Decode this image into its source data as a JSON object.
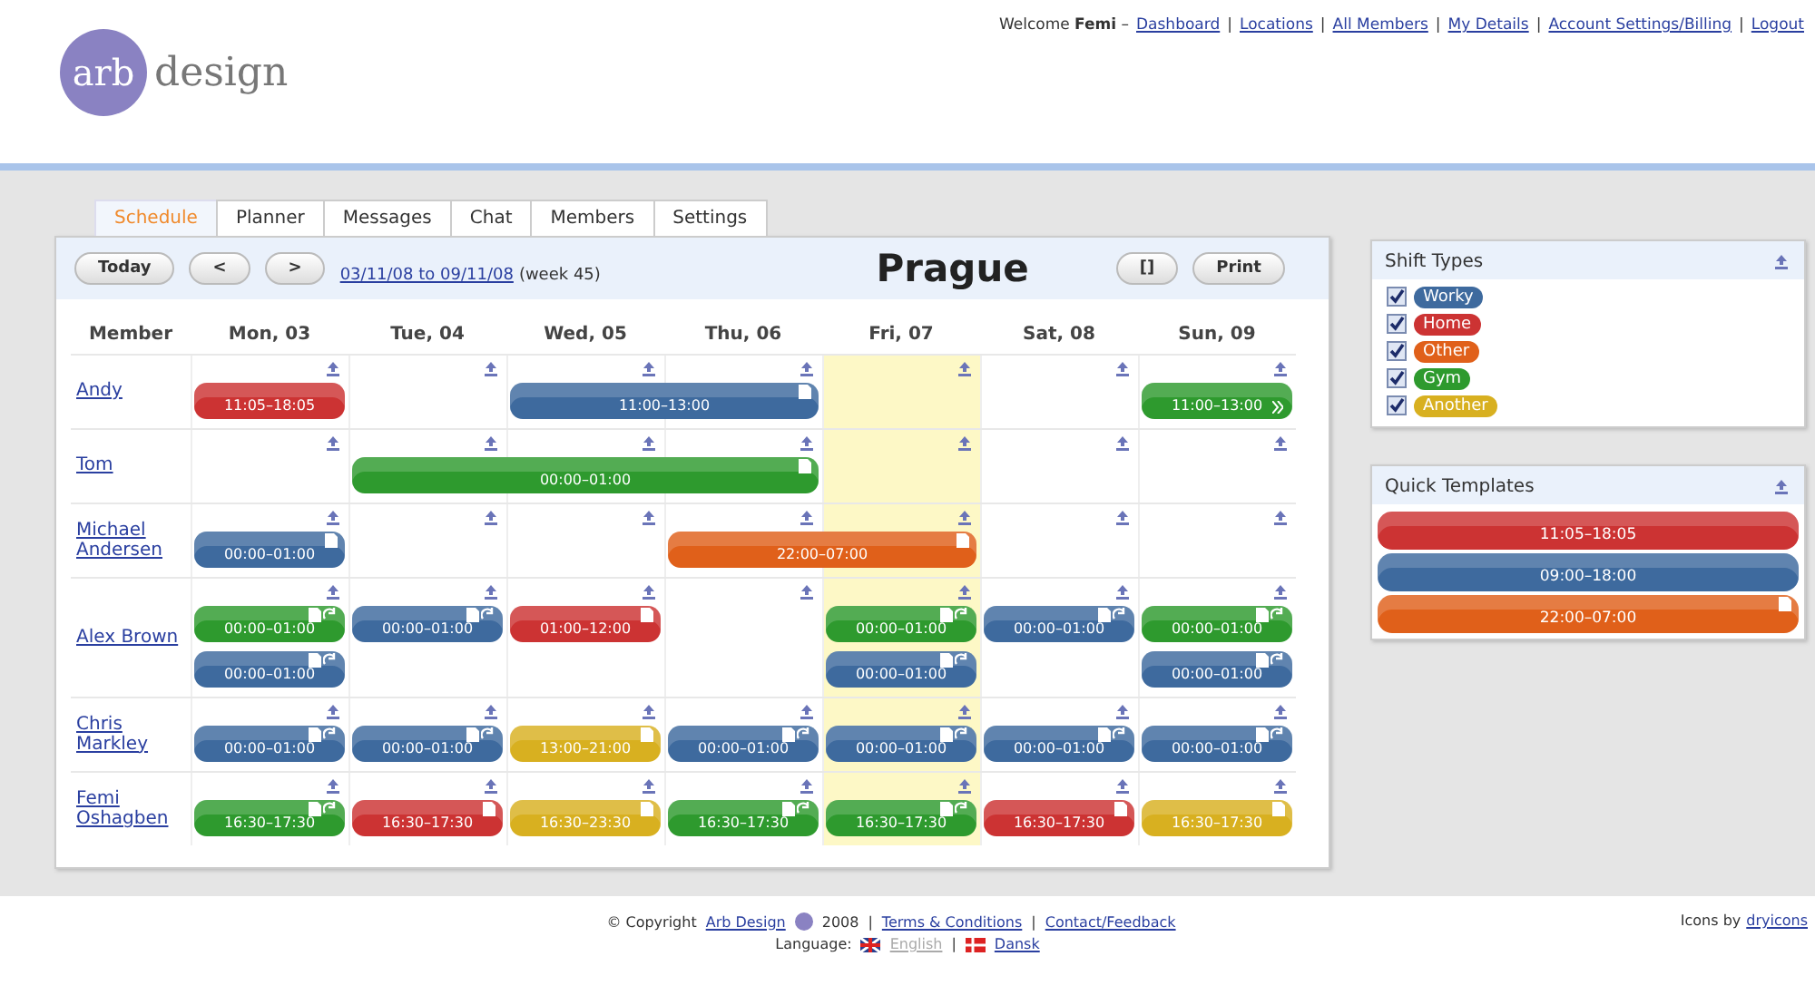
{
  "header": {
    "logo": {
      "mark": "arb",
      "word": "design"
    },
    "welcome": "Welcome **Femi** –",
    "links": [
      {
        "label": "Dashboard"
      },
      {
        "separator": "|",
        "label": "Locations"
      },
      {
        "separator": "|",
        "label": "All Members"
      },
      {
        "separator": "|",
        "label": "My Details"
      },
      {
        "separator": "|",
        "label": "Account Settings/Billing"
      },
      {
        "separator": "|",
        "label": "Logout"
      }
    ]
  },
  "tabs": [
    {
      "label": "Schedule",
      "selected": true
    },
    {
      "label": "Planner",
      "selected": false
    },
    {
      "label": "Messages",
      "selected": false
    },
    {
      "label": "Chat",
      "selected": false
    },
    {
      "label": "Members",
      "selected": false
    },
    {
      "label": "Settings",
      "selected": false
    }
  ],
  "toolbar": {
    "today": "Today",
    "prev": "<",
    "next": ">",
    "range": "03/11/08 to 09/11/08",
    "week": "(week 45)",
    "location": "Prague",
    "toggle": "[]",
    "print": "Print"
  },
  "member_heading": "Member",
  "days": [
    {
      "label": "Mon, 03",
      "highlighted": false
    },
    {
      "label": "Tue, 04",
      "highlighted": false
    },
    {
      "label": "Wed, 05",
      "highlighted": false
    },
    {
      "label": "Thu, 06",
      "highlighted": false
    },
    {
      "label": "Fri, 07",
      "highlighted": true
    },
    {
      "label": "Sat, 08",
      "highlighted": false
    },
    {
      "label": "Sun, 09",
      "highlighted": false
    }
  ],
  "members": [
    {
      "name": "Andy",
      "lanes": [
        {
          "cells": [
            {
              "kind": "shift",
              "time": "11:05–18:05",
              "color": "#cc3333",
              "note": false,
              "repeat": false,
              "more": false
            },
            {
              "kind": "empty"
            },
            {
              "kind": "shift",
              "time": "11:00–13:00",
              "color": "#3e6a9e",
              "note": true,
              "repeat": false,
              "more": false
            },
            {
              "kind": "continued"
            },
            {
              "kind": "empty"
            },
            {
              "kind": "empty"
            },
            {
              "kind": "shift",
              "time": "11:00–13:00",
              "color": "#2e9a2e",
              "note": false,
              "repeat": false,
              "more": true
            }
          ]
        }
      ]
    },
    {
      "name": "Tom",
      "lanes": [
        {
          "cells": [
            {
              "kind": "empty"
            },
            {
              "kind": "shift",
              "time": "00:00–01:00",
              "color": "#2e9a2e",
              "note": true,
              "repeat": false,
              "more": false
            },
            {
              "kind": "continued"
            },
            {
              "kind": "continued"
            },
            {
              "kind": "empty"
            },
            {
              "kind": "empty"
            },
            {
              "kind": "empty"
            }
          ]
        }
      ]
    },
    {
      "name": "Michael Andersen",
      "lanes": [
        {
          "cells": [
            {
              "kind": "shift",
              "time": "00:00–01:00",
              "color": "#3e6a9e",
              "note": true,
              "repeat": false,
              "more": false
            },
            {
              "kind": "empty"
            },
            {
              "kind": "empty"
            },
            {
              "kind": "shift",
              "time": "22:00–07:00",
              "color": "#e0601a",
              "note": true,
              "repeat": false,
              "more": false
            },
            {
              "kind": "continued"
            },
            {
              "kind": "empty"
            },
            {
              "kind": "empty"
            }
          ]
        }
      ]
    },
    {
      "name": "Alex Brown",
      "lanes": [
        {
          "cells": [
            {
              "kind": "shift",
              "time": "00:00–01:00",
              "color": "#2e9a2e",
              "note": true,
              "repeat": true,
              "more": false
            },
            {
              "kind": "shift",
              "time": "00:00–01:00",
              "color": "#3e6a9e",
              "note": true,
              "repeat": true,
              "more": false
            },
            {
              "kind": "shift",
              "time": "01:00–12:00",
              "color": "#cc3333",
              "note": true,
              "repeat": false,
              "more": false
            },
            {
              "kind": "empty"
            },
            {
              "kind": "shift",
              "time": "00:00–01:00",
              "color": "#2e9a2e",
              "note": true,
              "repeat": true,
              "more": false
            },
            {
              "kind": "shift",
              "time": "00:00–01:00",
              "color": "#3e6a9e",
              "note": true,
              "repeat": true,
              "more": false
            },
            {
              "kind": "shift",
              "time": "00:00–01:00",
              "color": "#2e9a2e",
              "note": true,
              "repeat": true,
              "more": false
            }
          ]
        },
        {
          "cells": [
            {
              "kind": "shift",
              "time": "00:00–01:00",
              "color": "#3e6a9e",
              "note": true,
              "repeat": true,
              "more": false
            },
            {
              "kind": "empty"
            },
            {
              "kind": "empty"
            },
            {
              "kind": "empty"
            },
            {
              "kind": "shift",
              "time": "00:00–01:00",
              "color": "#3e6a9e",
              "note": true,
              "repeat": true,
              "more": false
            },
            {
              "kind": "empty"
            },
            {
              "kind": "shift",
              "time": "00:00–01:00",
              "color": "#3e6a9e",
              "note": true,
              "repeat": true,
              "more": false
            }
          ]
        }
      ]
    },
    {
      "name": "Chris Markley",
      "lanes": [
        {
          "cells": [
            {
              "kind": "shift",
              "time": "00:00–01:00",
              "color": "#3e6a9e",
              "note": true,
              "repeat": true,
              "more": false
            },
            {
              "kind": "shift",
              "time": "00:00–01:00",
              "color": "#3e6a9e",
              "note": true,
              "repeat": true,
              "more": false
            },
            {
              "kind": "shift",
              "time": "13:00–21:00",
              "color": "#d8b020",
              "note": true,
              "repeat": false,
              "more": false
            },
            {
              "kind": "shift",
              "time": "00:00–01:00",
              "color": "#3e6a9e",
              "note": true,
              "repeat": true,
              "more": false
            },
            {
              "kind": "shift",
              "time": "00:00–01:00",
              "color": "#3e6a9e",
              "note": true,
              "repeat": true,
              "more": false
            },
            {
              "kind": "shift",
              "time": "00:00–01:00",
              "color": "#3e6a9e",
              "note": true,
              "repeat": true,
              "more": false
            },
            {
              "kind": "shift",
              "time": "00:00–01:00",
              "color": "#3e6a9e",
              "note": true,
              "repeat": true,
              "more": false
            }
          ]
        }
      ]
    },
    {
      "name": "Femi Oshagben",
      "lanes": [
        {
          "cells": [
            {
              "kind": "shift",
              "time": "16:30–17:30",
              "color": "#2e9a2e",
              "note": true,
              "repeat": true,
              "more": false
            },
            {
              "kind": "shift",
              "time": "16:30–17:30",
              "color": "#cc3333",
              "note": true,
              "repeat": false,
              "more": false
            },
            {
              "kind": "shift",
              "time": "16:30–23:30",
              "color": "#d8b020",
              "note": true,
              "repeat": false,
              "more": false
            },
            {
              "kind": "shift",
              "time": "16:30–17:30",
              "color": "#2e9a2e",
              "note": true,
              "repeat": true,
              "more": false
            },
            {
              "kind": "shift",
              "time": "16:30–17:30",
              "color": "#2e9a2e",
              "note": true,
              "repeat": true,
              "more": false
            },
            {
              "kind": "shift",
              "time": "16:30–17:30",
              "color": "#cc3333",
              "note": true,
              "repeat": false,
              "more": false
            },
            {
              "kind": "shift",
              "time": "16:30–17:30",
              "color": "#d8b020",
              "note": true,
              "repeat": false,
              "more": false
            }
          ]
        }
      ]
    }
  ],
  "shift_types": {
    "title": "Shift Types",
    "items": [
      {
        "label": "Worky",
        "color": "#3e6a9e",
        "checked": true
      },
      {
        "label": "Home",
        "color": "#cc3333",
        "checked": true
      },
      {
        "label": "Other",
        "color": "#e0601a",
        "checked": true
      },
      {
        "label": "Gym",
        "color": "#2e9a2e",
        "checked": true
      },
      {
        "label": "Another",
        "color": "#d8b020",
        "checked": true
      }
    ]
  },
  "quick_templates": {
    "title": "Quick Templates",
    "items": [
      {
        "time": "11:05–18:05",
        "color": "#cc3333",
        "note": false
      },
      {
        "time": "09:00–18:00",
        "color": "#3e6a9e",
        "note": false
      },
      {
        "time": "22:00–07:00",
        "color": "#e0601a",
        "note": true
      }
    ]
  },
  "footer": {
    "copyright": "© Copyright",
    "company": "Arb Design",
    "year": "2008",
    "links": [
      {
        "separator": "|",
        "label": "Terms & Conditions"
      },
      {
        "separator": "|",
        "label": "Contact/Feedback"
      }
    ],
    "language_label": "Language:",
    "languages": [
      {
        "label": "English",
        "selected": true
      },
      {
        "separator": "|",
        "label": "Dansk",
        "selected": false
      }
    ],
    "credit": "Icons by",
    "credit_link": "dryicons"
  }
}
